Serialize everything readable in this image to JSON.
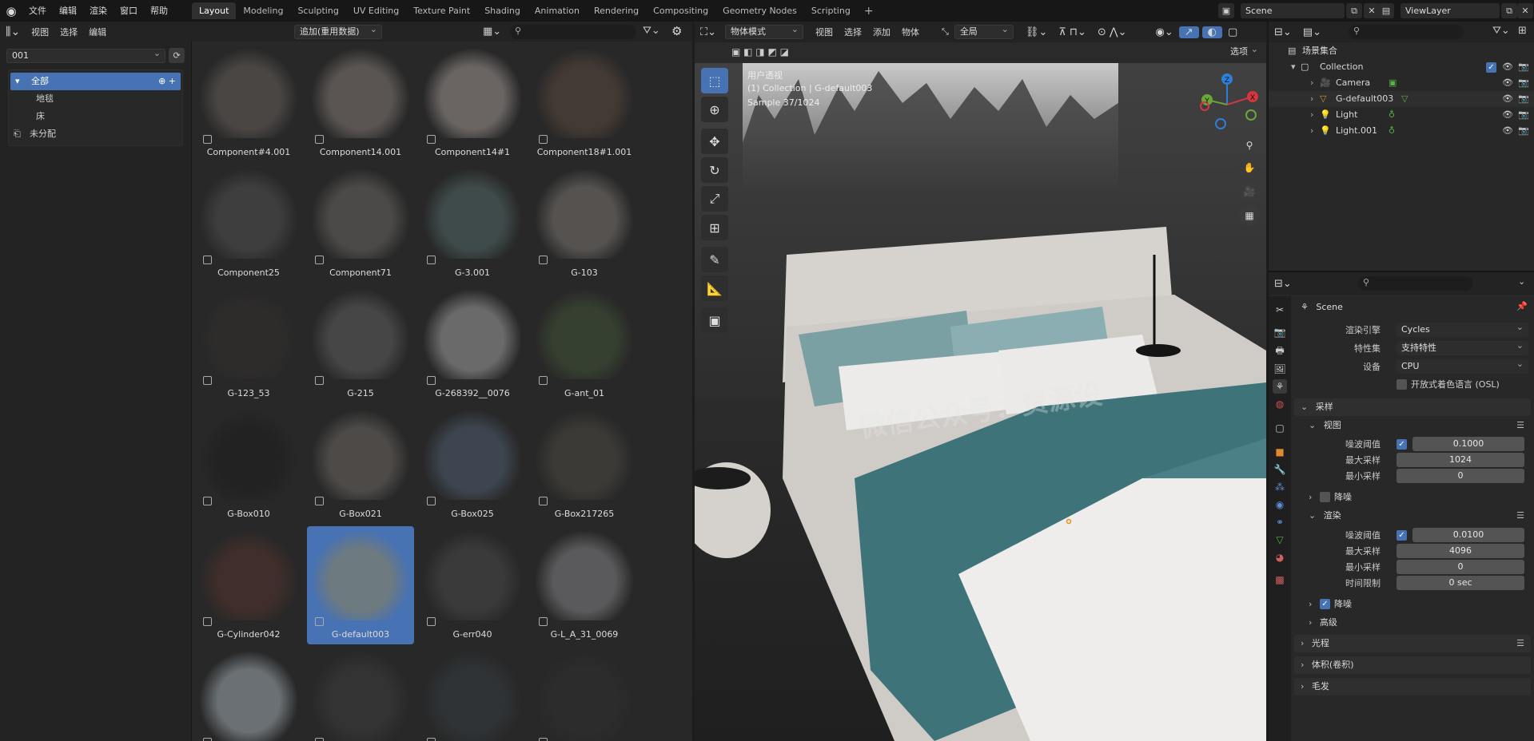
{
  "topbar": {
    "menus": [
      "文件",
      "编辑",
      "渲染",
      "窗口",
      "帮助"
    ],
    "workspace_tabs": [
      "Layout",
      "Modeling",
      "Sculpting",
      "UV Editing",
      "Texture Paint",
      "Shading",
      "Animation",
      "Rendering",
      "Compositing",
      "Geometry Nodes",
      "Scripting"
    ],
    "active_tab": "Layout",
    "scene_name": "Scene",
    "view_layer": "ViewLayer"
  },
  "asset_browser": {
    "menus": [
      "视图",
      "选择",
      "编辑"
    ],
    "import_mode": "追加(重用数据)",
    "library": "001",
    "categories": [
      {
        "label": "全部",
        "active": true
      },
      {
        "label": "地毯",
        "active": false
      },
      {
        "label": "床",
        "active": false
      },
      {
        "label": "未分配",
        "active": false
      }
    ],
    "assets": [
      {
        "name": "Component#4.001",
        "color": "#4a4644"
      },
      {
        "name": "Component14.001",
        "color": "#5a5552"
      },
      {
        "name": "Component14#1",
        "color": "#6a6563"
      },
      {
        "name": "Component18#1.001",
        "color": "#443a34"
      },
      {
        "name": "Component25",
        "color": "#3e3e3e"
      },
      {
        "name": "Component71",
        "color": "#4c4a48"
      },
      {
        "name": "G-3.001",
        "color": "#3f4a4a"
      },
      {
        "name": "G-103",
        "color": "#555250"
      },
      {
        "name": "G-123_53",
        "color": "#2e2c2b"
      },
      {
        "name": "G-215",
        "color": "#464646"
      },
      {
        "name": "G-268392__0076",
        "color": "#6a6a6a"
      },
      {
        "name": "G-ant_01",
        "color": "#364030"
      },
      {
        "name": "G-Box010",
        "color": "#222222"
      },
      {
        "name": "G-Box021",
        "color": "#4d4a48"
      },
      {
        "name": "G-Box025",
        "color": "#3d4650"
      },
      {
        "name": "G-Box217265",
        "color": "#3b3a36"
      },
      {
        "name": "G-Cylinder042",
        "color": "#3f2e2a"
      },
      {
        "name": "G-default003",
        "color": "#6d7a80"
      },
      {
        "name": "G-err040",
        "color": "#3a3a3a"
      },
      {
        "name": "G-L_A_31_0069",
        "color": "#5a5a5c"
      },
      {
        "name": "",
        "color": "#6a7074"
      },
      {
        "name": "",
        "color": "#333333"
      },
      {
        "name": "",
        "color": "#2f3336"
      },
      {
        "name": "",
        "color": "#2c2c2c"
      }
    ],
    "selected_asset": "G-default003"
  },
  "viewport": {
    "mode": "物体模式",
    "menus": [
      "视图",
      "选择",
      "添加",
      "物体"
    ],
    "transform_orientation": "全局",
    "options_label": "选项",
    "info_line1": "用户透视",
    "info_line2": "(1) Collection | G-default003",
    "info_line3": "Sample 37/1024",
    "gizmo_axes": [
      "X",
      "Y",
      "Z"
    ],
    "watermark": "微信公众号：资源设"
  },
  "outliner": {
    "root": "场景集合",
    "collection": "Collection",
    "objects": [
      "Camera",
      "G-default003",
      "Light",
      "Light.001"
    ]
  },
  "properties": {
    "context": "Scene",
    "render_engine_label": "渲染引擎",
    "render_engine": "Cycles",
    "feature_set_label": "特性集",
    "feature_set": "支持特性",
    "device_label": "设备",
    "device": "CPU",
    "osl_label": "开放式着色语言 (OSL)",
    "sampling": "采样",
    "viewport_section": "视图",
    "noise_threshold_label": "噪波阈值",
    "viewport_noise_threshold": "0.1000",
    "max_samples_label": "最大采样",
    "viewport_max_samples": "1024",
    "min_samples_label": "最小采样",
    "viewport_min_samples": "0",
    "denoise_label": "降噪",
    "render_section": "渲染",
    "render_noise_threshold": "0.0100",
    "render_max_samples": "4096",
    "render_min_samples": "0",
    "time_limit_label": "时间限制",
    "time_limit": "0 sec",
    "advanced": "高级",
    "light_paths": "光程",
    "volumes": "体积(卷积)",
    "hair": "毛发"
  }
}
